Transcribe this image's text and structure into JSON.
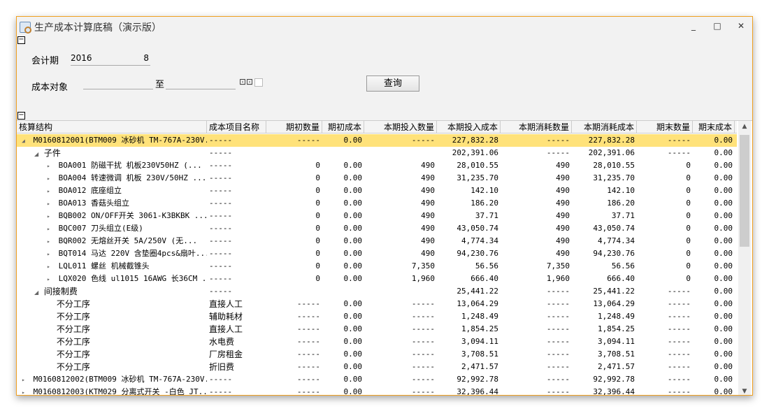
{
  "window": {
    "title": "生产成本计算底稿（演示版）",
    "minimize": "_",
    "maximize": "□",
    "close": "✕"
  },
  "filters": {
    "period_label": "会计期",
    "year": "2016",
    "month": "8",
    "object_label": "成本对象",
    "to_label": "至",
    "object_from": "",
    "object_to": "",
    "query_button": "查询",
    "collapse_glyph": "⊟"
  },
  "columns": [
    "核算结构",
    "成本项目名称",
    "期初数量",
    "期初成本",
    "本期投入数量",
    "本期投入成本",
    "本期消耗数量",
    "本期消耗成本",
    "期末数量",
    "期末成本"
  ],
  "rows": [
    {
      "level": 0,
      "toggle": "◢",
      "name": "M0160812001(BTM009 冰砂机 TM-767A-230V...",
      "item": "-----",
      "v": [
        "-----",
        "0.00",
        "-----",
        "227,832.28",
        "-----",
        "227,832.28",
        "-----",
        "0.00"
      ],
      "selected": true
    },
    {
      "level": 1,
      "toggle": "◢",
      "name": "子件",
      "item": "-----",
      "v": [
        "",
        "",
        "",
        "202,391.06",
        "-----",
        "202,391.06",
        "-----",
        "0.00"
      ],
      "text": true
    },
    {
      "level": 2,
      "toggle": "▸",
      "name": "BOA001 防磁干扰 机板230V50HZ  (...",
      "item": "-----",
      "v": [
        "0",
        "0.00",
        "490",
        "28,010.55",
        "490",
        "28,010.55",
        "0",
        "0.00"
      ]
    },
    {
      "level": 2,
      "toggle": "▸",
      "name": "BOA004 转速微调 机板 230V/50HZ  ...",
      "item": "-----",
      "v": [
        "0",
        "0.00",
        "490",
        "31,235.70",
        "490",
        "31,235.70",
        "0",
        "0.00"
      ]
    },
    {
      "level": 2,
      "toggle": "▸",
      "name": "BOA012 底座组立",
      "item": "-----",
      "v": [
        "0",
        "0.00",
        "490",
        "142.10",
        "490",
        "142.10",
        "0",
        "0.00"
      ]
    },
    {
      "level": 2,
      "toggle": "▸",
      "name": "BOA013 香菇头组立",
      "item": "-----",
      "v": [
        "0",
        "0.00",
        "490",
        "186.20",
        "490",
        "186.20",
        "0",
        "0.00"
      ]
    },
    {
      "level": 2,
      "toggle": "▸",
      "name": "BQB002 ON/OFF开关  3061-K3BKBK  ...",
      "item": "-----",
      "v": [
        "0",
        "0.00",
        "490",
        "37.71",
        "490",
        "37.71",
        "0",
        "0.00"
      ]
    },
    {
      "level": 2,
      "toggle": "▸",
      "name": "BQC007 刀头组立(E级)",
      "item": "-----",
      "v": [
        "0",
        "0.00",
        "490",
        "43,050.74",
        "490",
        "43,050.74",
        "0",
        "0.00"
      ]
    },
    {
      "level": 2,
      "toggle": "▸",
      "name": "BQR002 无熔丝开关  5A/250V  (无...",
      "item": "-----",
      "v": [
        "0",
        "0.00",
        "490",
        "4,774.34",
        "490",
        "4,774.34",
        "0",
        "0.00"
      ]
    },
    {
      "level": 2,
      "toggle": "▸",
      "name": "BQT014 马达 220V 含垫圈4pcs&扇叶...",
      "item": "-----",
      "v": [
        "0",
        "0.00",
        "490",
        "94,230.76",
        "490",
        "94,230.76",
        "0",
        "0.00"
      ]
    },
    {
      "level": 2,
      "toggle": "▸",
      "name": "LQL011 螺丝 机械截锥头",
      "item": "-----",
      "v": [
        "0",
        "0.00",
        "7,350",
        "56.56",
        "7,350",
        "56.56",
        "0",
        "0.00"
      ]
    },
    {
      "level": 2,
      "toggle": "▸",
      "name": "LQX020 色线 ul1015 16AWG 长36CM ...",
      "item": "-----",
      "v": [
        "0",
        "0.00",
        "1,960",
        "666.40",
        "1,960",
        "666.40",
        "0",
        "0.00"
      ]
    },
    {
      "level": 1,
      "toggle": "◢",
      "name": "间接制费",
      "item": "-----",
      "v": [
        "",
        "",
        "",
        "25,441.22",
        "-----",
        "25,441.22",
        "-----",
        "0.00"
      ],
      "text": true
    },
    {
      "level": 2,
      "toggle": "",
      "name": "不分工序",
      "item": "直接人工",
      "v": [
        "-----",
        "0.00",
        "-----",
        "13,064.29",
        "-----",
        "13,064.29",
        "-----",
        "0.00"
      ],
      "text": true
    },
    {
      "level": 2,
      "toggle": "",
      "name": "不分工序",
      "item": "辅助耗材",
      "v": [
        "-----",
        "0.00",
        "-----",
        "1,248.49",
        "-----",
        "1,248.49",
        "-----",
        "0.00"
      ],
      "text": true
    },
    {
      "level": 2,
      "toggle": "",
      "name": "不分工序",
      "item": "直接人工",
      "v": [
        "-----",
        "0.00",
        "-----",
        "1,854.25",
        "-----",
        "1,854.25",
        "-----",
        "0.00"
      ],
      "text": true
    },
    {
      "level": 2,
      "toggle": "",
      "name": "不分工序",
      "item": "水电费",
      "v": [
        "-----",
        "0.00",
        "-----",
        "3,094.11",
        "-----",
        "3,094.11",
        "-----",
        "0.00"
      ],
      "text": true
    },
    {
      "level": 2,
      "toggle": "",
      "name": "不分工序",
      "item": "厂房租金",
      "v": [
        "-----",
        "0.00",
        "-----",
        "3,708.51",
        "-----",
        "3,708.51",
        "-----",
        "0.00"
      ],
      "text": true
    },
    {
      "level": 2,
      "toggle": "",
      "name": "不分工序",
      "item": "折旧费",
      "v": [
        "-----",
        "0.00",
        "-----",
        "2,471.57",
        "-----",
        "2,471.57",
        "-----",
        "0.00"
      ],
      "text": true
    },
    {
      "level": 0,
      "toggle": "▸",
      "name": "M0160812002(BTM009 冰砂机 TM-767A-230V...",
      "item": "-----",
      "v": [
        "-----",
        "0.00",
        "-----",
        "92,992.78",
        "-----",
        "92,992.78",
        "-----",
        "0.00"
      ]
    },
    {
      "level": 0,
      "toggle": "▸",
      "name": "M0160812003(KTM029 分离式开关 -白色 JT...",
      "item": "-----",
      "v": [
        "-----",
        "0.00",
        "-----",
        "32,396.44",
        "-----",
        "32,396.44",
        "-----",
        "0.00"
      ]
    }
  ],
  "colors": {
    "selected_row": "#ffe27a",
    "window_border": "#f0a020"
  }
}
